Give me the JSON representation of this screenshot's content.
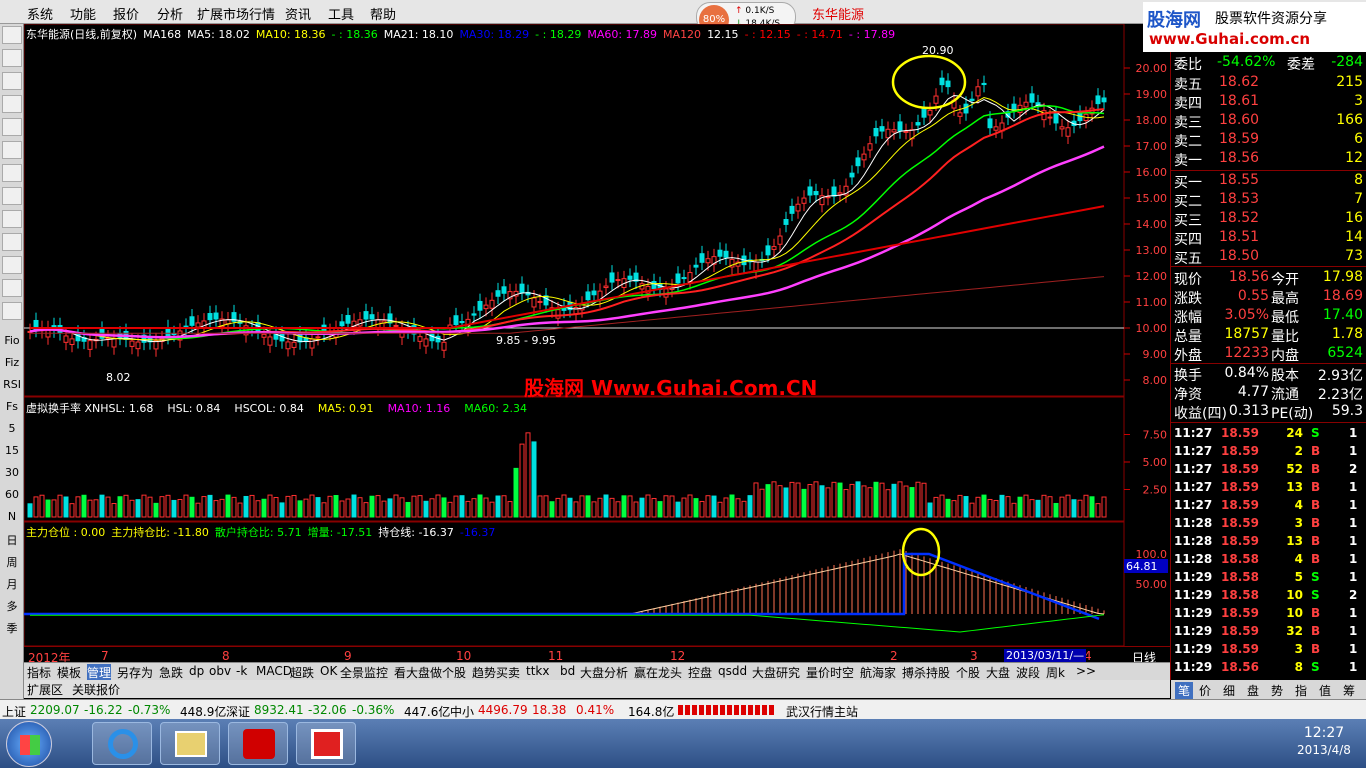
{
  "menu": [
    "系统",
    "功能",
    "报价",
    "分析",
    "扩展市场行情",
    "资讯",
    "工具",
    "帮助"
  ],
  "net": {
    "percent": "80%",
    "up": "0.1K/S",
    "down": "18.4K/S"
  },
  "stock_title": "东华能源",
  "brand": {
    "name": "股海网",
    "slogan": "股票软件资源分享",
    "url": "www.Guhai.com.cn"
  },
  "watermark": "股海网 Www.Guhai.Com.CN",
  "sidebar": [
    "Fio",
    "Fiz",
    "RSI",
    "Fs",
    "5",
    "15",
    "30",
    "60",
    "N",
    "日",
    "周",
    "月",
    "多",
    "季"
  ],
  "main_legend": {
    "name": "东华能源(日线,前复权)",
    "items": [
      {
        "t": "MA168",
        "c": "#ffffff"
      },
      {
        "t": "MA5: 18.02",
        "c": "#ffffff"
      },
      {
        "t": "MA10: 18.36",
        "c": "#ffff00"
      },
      {
        "t": "- : 18.36",
        "c": "#00ff00"
      },
      {
        "t": "MA21: 18.10",
        "c": "#ffffff"
      },
      {
        "t": "MA30: 18.29",
        "c": "#0000ff"
      },
      {
        "t": "- : 18.29",
        "c": "#00ff00"
      },
      {
        "t": "MA60: 17.89",
        "c": "#ff00ff"
      },
      {
        "t": "MA120",
        "c": "#ff4444"
      },
      {
        "t": "12.15",
        "c": "#ffffff"
      },
      {
        "t": "- : 12.15",
        "c": "#ff0000"
      },
      {
        "t": "- : 14.71",
        "c": "#ff0000"
      },
      {
        "t": "- : 17.89",
        "c": "#ff00ff"
      }
    ]
  },
  "price_axis": [
    "20.00",
    "19.00",
    "18.00",
    "17.00",
    "16.00",
    "15.00",
    "14.00",
    "13.00",
    "12.00",
    "11.00",
    "10.00",
    "9.00",
    "8.00"
  ],
  "annotations": {
    "high": "20.90",
    "low": "8.02",
    "mid": "9.85 - 9.95"
  },
  "vol_legend": [
    {
      "t": "虚拟换手率 XNHSL: 1.68",
      "c": "#ffffff"
    },
    {
      "t": "HSL: 0.84",
      "c": "#ffffff"
    },
    {
      "t": "HSCOL: 0.84",
      "c": "#ffffff"
    },
    {
      "t": "MA5: 0.91",
      "c": "#ffff00"
    },
    {
      "t": "MA10: 1.16",
      "c": "#ff00ff"
    },
    {
      "t": "MA60: 2.34",
      "c": "#00ff00"
    }
  ],
  "vol_axis": [
    "7.50",
    "5.00",
    "2.50"
  ],
  "pos_legend": [
    {
      "t": "主力仓位 : 0.00",
      "c": "#ffff00"
    },
    {
      "t": "主力持仓比: -11.80",
      "c": "#ffff00"
    },
    {
      "t": "散户持仓比: 5.71",
      "c": "#00ff00"
    },
    {
      "t": "增量: -17.51",
      "c": "#00ff00"
    },
    {
      "t": "持仓线: -16.37",
      "c": "#ffffff"
    },
    {
      "t": "-16.37",
      "c": "#0000ff"
    }
  ],
  "pos_axis": [
    "100.0",
    "50.00"
  ],
  "pos_value": "64.81",
  "date_axis": {
    "year": "2012年",
    "months": [
      "7",
      "8",
      "9",
      "10",
      "11",
      "12",
      "2",
      "3",
      "4"
    ],
    "cursor_date": "2013/03/11/—",
    "period": "日线"
  },
  "quote": {
    "wb": {
      "label": "委比",
      "value": "-54.62%",
      "label2": "委差",
      "value2": "-284"
    },
    "sell": [
      {
        "l": "卖五",
        "p": "18.62",
        "v": "215"
      },
      {
        "l": "卖四",
        "p": "18.61",
        "v": "3"
      },
      {
        "l": "卖三",
        "p": "18.60",
        "v": "166"
      },
      {
        "l": "卖二",
        "p": "18.59",
        "v": "6"
      },
      {
        "l": "卖一",
        "p": "18.56",
        "v": "12"
      }
    ],
    "buy": [
      {
        "l": "买一",
        "p": "18.55",
        "v": "8"
      },
      {
        "l": "买二",
        "p": "18.53",
        "v": "7"
      },
      {
        "l": "买三",
        "p": "18.52",
        "v": "16"
      },
      {
        "l": "买四",
        "p": "18.51",
        "v": "14"
      },
      {
        "l": "买五",
        "p": "18.50",
        "v": "73"
      }
    ],
    "stats": [
      {
        "l": "现价",
        "v": "18.56",
        "c": "#ff4040",
        "l2": "今开",
        "v2": "17.98",
        "c2": "#ffff00"
      },
      {
        "l": "涨跌",
        "v": "0.55",
        "c": "#ff4040",
        "l2": "最高",
        "v2": "18.69",
        "c2": "#ff4040"
      },
      {
        "l": "涨幅",
        "v": "3.05%",
        "c": "#ff4040",
        "l2": "最低",
        "v2": "17.40",
        "c2": "#00ff00"
      },
      {
        "l": "总量",
        "v": "18757",
        "c": "#ffff00",
        "l2": "量比",
        "v2": "1.78",
        "c2": "#ffff00"
      },
      {
        "l": "外盘",
        "v": "12233",
        "c": "#ff4040",
        "l2": "内盘",
        "v2": "6524",
        "c2": "#00ff00"
      }
    ],
    "stats2": [
      {
        "l": "换手",
        "v": "0.84%",
        "l2": "股本",
        "v2": "2.93亿"
      },
      {
        "l": "净资",
        "v": "4.77",
        "l2": "流通",
        "v2": "2.23亿"
      },
      {
        "l": "收益(四)",
        "v": "0.313",
        "l2": "PE(动)",
        "v2": "59.3"
      }
    ],
    "ticks": [
      {
        "t": "11:27",
        "p": "18.59",
        "v": "24",
        "s": "S",
        "n": "1"
      },
      {
        "t": "11:27",
        "p": "18.59",
        "v": "2",
        "s": "B",
        "n": "1"
      },
      {
        "t": "11:27",
        "p": "18.59",
        "v": "52",
        "s": "B",
        "n": "2"
      },
      {
        "t": "11:27",
        "p": "18.59",
        "v": "13",
        "s": "B",
        "n": "1"
      },
      {
        "t": "11:27",
        "p": "18.59",
        "v": "4",
        "s": "B",
        "n": "1"
      },
      {
        "t": "11:28",
        "p": "18.59",
        "v": "3",
        "s": "B",
        "n": "1"
      },
      {
        "t": "11:28",
        "p": "18.59",
        "v": "13",
        "s": "B",
        "n": "1"
      },
      {
        "t": "11:28",
        "p": "18.58",
        "v": "4",
        "s": "B",
        "n": "1"
      },
      {
        "t": "11:29",
        "p": "18.58",
        "v": "5",
        "s": "S",
        "n": "1"
      },
      {
        "t": "11:29",
        "p": "18.58",
        "v": "10",
        "s": "S",
        "n": "2"
      },
      {
        "t": "11:29",
        "p": "18.59",
        "v": "10",
        "s": "B",
        "n": "1"
      },
      {
        "t": "11:29",
        "p": "18.59",
        "v": "32",
        "s": "B",
        "n": "1"
      },
      {
        "t": "11:29",
        "p": "18.59",
        "v": "3",
        "s": "B",
        "n": "1"
      },
      {
        "t": "11:29",
        "p": "18.56",
        "v": "8",
        "s": "S",
        "n": "1"
      }
    ],
    "bottom_tabs": [
      "笔",
      "价",
      "细",
      "盘",
      "势",
      "指",
      "值",
      "筹"
    ]
  },
  "tabs": [
    "指标",
    "模板",
    "管理",
    "另存为",
    "急跌",
    "dp",
    "obv",
    "-k",
    "MACD",
    "超跌",
    "OK",
    "全景监控",
    "看大盘做个股",
    "趋势买卖",
    "ttkx",
    "bd",
    "大盘分析",
    "赢在龙头",
    "控盘",
    "qsdd",
    "大盘研究",
    "量价时空",
    "航海家",
    "搏杀持股",
    "个股",
    "大盘",
    "波段",
    "周k",
    ">>"
  ],
  "subtabs": [
    "扩展区",
    "关联报价"
  ],
  "status": {
    "sh": {
      "l": "上证",
      "v": "2209.07",
      "c": "-16.22",
      "p": "-0.73%",
      "a": "448.9亿"
    },
    "sz": {
      "l": "深证",
      "v": "8932.41",
      "c": "-32.06",
      "p": "-0.36%",
      "a": "447.6亿"
    },
    "zx": {
      "l": "中小",
      "v": "4496.79",
      "c": "18.38",
      "p": "0.41%",
      "a": "164.8亿"
    },
    "server": "武汉行情主站"
  },
  "clock": {
    "time": "12:27",
    "date": "2013/4/8"
  }
}
